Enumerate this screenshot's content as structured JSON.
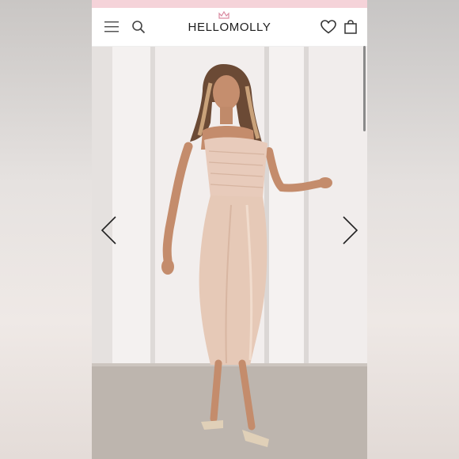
{
  "header": {
    "brand": "HELLOMOLLY",
    "icons": [
      "menu-icon",
      "search-icon",
      "heart-icon",
      "shopping-bag-icon"
    ]
  },
  "hero": {
    "arrows": [
      "chevron-left-icon",
      "chevron-right-icon"
    ]
  },
  "colors": {
    "promo_bar": "#f5d3d9",
    "dress": "#e6c9b7",
    "floor": "#bdb5ae",
    "wall": "#efebea"
  }
}
